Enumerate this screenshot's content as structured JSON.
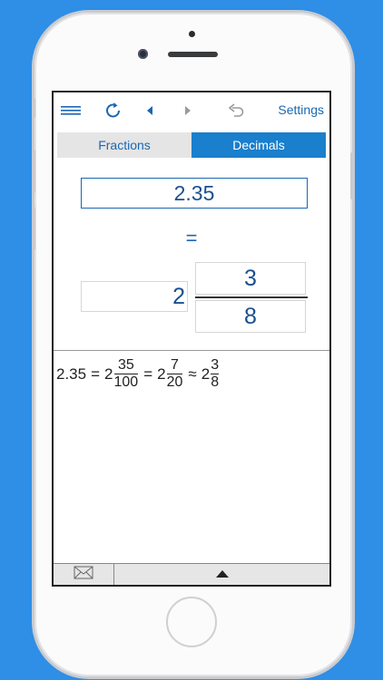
{
  "toolbar": {
    "menu_icon": "hamburger-icon",
    "refresh_icon": "refresh-icon",
    "back_icon": "triangle-left-icon",
    "forward_icon": "triangle-right-icon",
    "undo_icon": "undo-icon",
    "settings_label": "Settings"
  },
  "tabs": [
    {
      "label": "Fractions",
      "active": false
    },
    {
      "label": "Decimals",
      "active": true
    }
  ],
  "converter": {
    "decimal_value": "2.35",
    "equals": "=",
    "whole": "2",
    "numerator": "3",
    "denominator": "8"
  },
  "result": {
    "lhs": "2.35",
    "eq1": "=",
    "whole1": "2",
    "num1": "35",
    "den1": "100",
    "eq2": "=",
    "whole2": "2",
    "num2": "7",
    "den2": "20",
    "approx": "≈",
    "whole3": "2",
    "num3": "3",
    "den3": "8"
  },
  "bottom": {
    "mail_icon": "envelope-icon",
    "expand_icon": "triangle-up-icon"
  },
  "colors": {
    "background": "#2f8ee6",
    "accent": "#1a67b3",
    "active_tab": "#1a7fcc"
  }
}
